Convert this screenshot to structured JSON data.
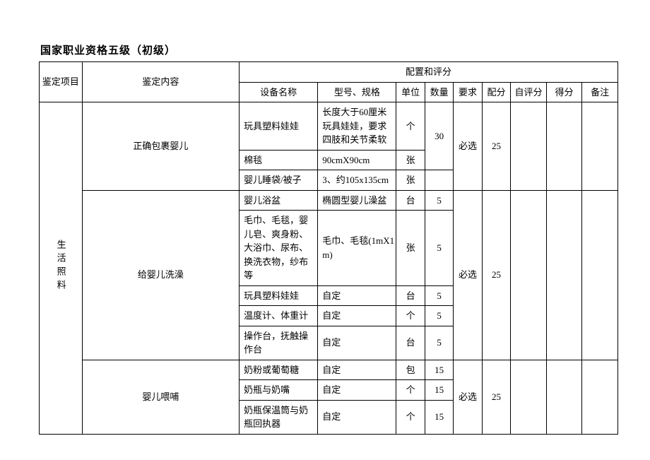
{
  "title": "国家职业资格五级（初级）",
  "headers": {
    "project": "鉴定项目",
    "content": "鉴定内容",
    "config": "配置和评分",
    "equip": "设备名称",
    "spec": "型号、规格",
    "unit": "单位",
    "qty": "数量",
    "req": "要求",
    "score": "配分",
    "self": "自评分",
    "get": "得分",
    "note": "备注"
  },
  "project": "生活照料",
  "groups": [
    {
      "content": "正确包裹婴儿",
      "req": "必选",
      "score": "25",
      "rows": [
        {
          "equip": "玩具塑料娃娃",
          "spec": "长度大于60厘米玩具娃娃，要求四肢和关节柔软",
          "unit": "个",
          "qty": "30",
          "qtyspan": 1
        },
        {
          "equip": "棉毯",
          "spec": "90cmX90cm",
          "unit": "张"
        },
        {
          "equip": "婴儿睡袋/被子",
          "spec": "3、约105x135cm",
          "unit": "张"
        }
      ]
    },
    {
      "content": "给婴儿洗澡",
      "req": "必选",
      "score": "25",
      "rows": [
        {
          "equip": "婴儿浴盆",
          "spec": "椭圆型婴儿澡盆",
          "unit": "台",
          "qty": "5"
        },
        {
          "equip": "毛巾、毛毯，婴儿皂、爽身粉、大浴巾、尿布、换洗衣物，纱布等",
          "spec": "毛巾、毛毯(1mX1m)",
          "unit": "张",
          "qty": "5"
        },
        {
          "equip": "玩具塑料娃娃",
          "spec": "自定",
          "unit": "台",
          "qty": "5"
        },
        {
          "equip": "温度计、体重计",
          "spec": "自定",
          "unit": "个",
          "qty": "5"
        },
        {
          "equip": "操作台，抚触操作台",
          "spec": "自定",
          "unit": "台",
          "qty": "5"
        }
      ]
    },
    {
      "content": "婴儿喂哺",
      "req": "必选",
      "score": "25",
      "rows": [
        {
          "equip": "奶粉或葡萄糖",
          "spec": "自定",
          "unit": "包",
          "qty": "15"
        },
        {
          "equip": "奶瓶与奶嘴",
          "spec": "自定",
          "unit": "个",
          "qty": "15"
        },
        {
          "equip": "奶瓶保温筒与奶瓶回执器",
          "spec": "自定",
          "unit": "个",
          "qty": "15"
        }
      ]
    }
  ]
}
